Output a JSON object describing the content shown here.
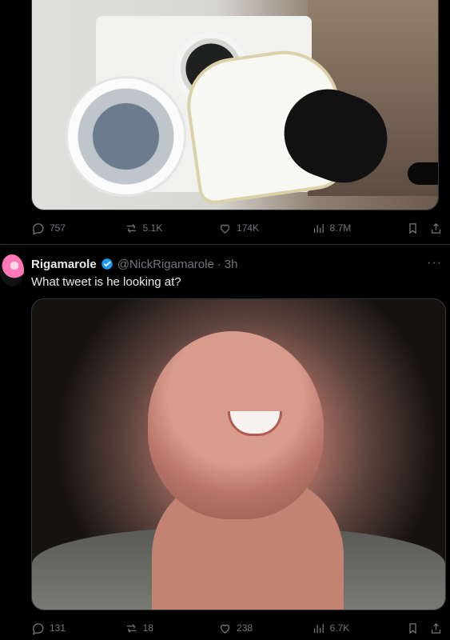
{
  "top_tweet": {
    "stats": {
      "replies": "757",
      "reposts": "5.1K",
      "likes": "174K",
      "views": "8.7M"
    }
  },
  "bottom_tweet": {
    "author_name": "Rigamarole",
    "handle": "@NickRigamarole",
    "dot": "·",
    "time": "3h",
    "text": "What tweet is he looking at?",
    "stats": {
      "replies": "131",
      "reposts": "18",
      "likes": "238",
      "views": "6.7K"
    }
  },
  "icons": {
    "reply": "reply-icon",
    "repost": "repost-icon",
    "like": "like-icon",
    "views": "views-icon",
    "bookmark": "bookmark-icon",
    "share": "share-icon",
    "verified": "verified-badge-icon",
    "more": "more-icon"
  },
  "colors": {
    "background": "#000000",
    "text_primary": "#e7e9ea",
    "text_secondary": "#71767b",
    "accent": "#1d9bf0",
    "divider": "#2f3336"
  }
}
